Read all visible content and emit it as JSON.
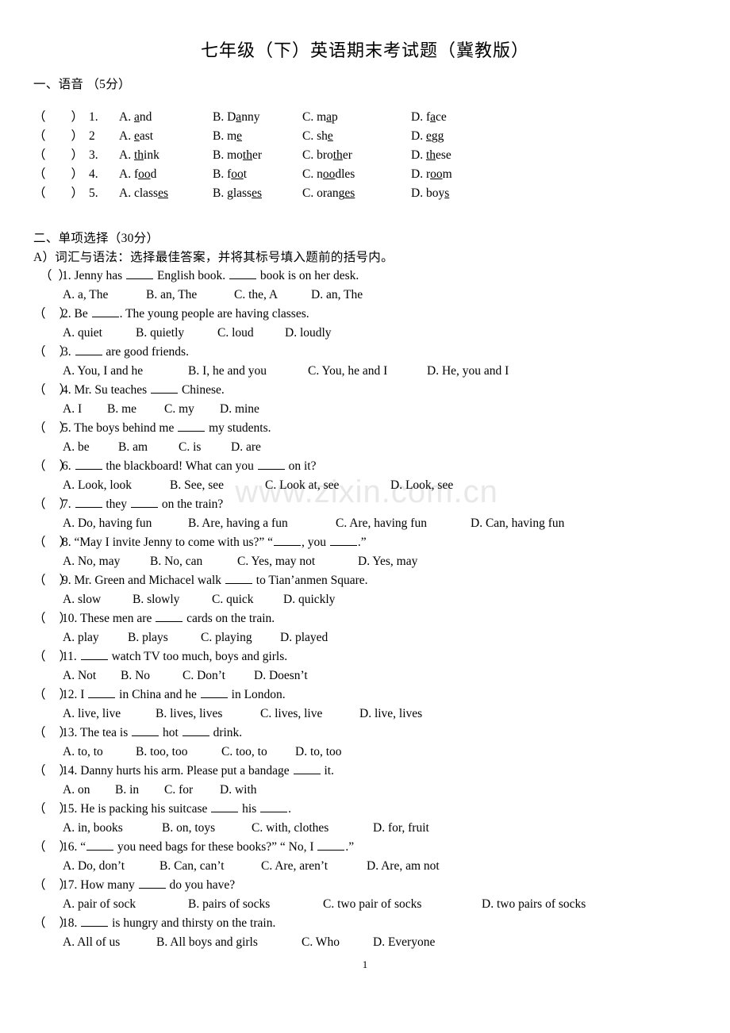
{
  "document": {
    "title": "七年级（下）英语期末考试题（冀教版）",
    "page_number": "1",
    "watermark": "www.zixin.com.cn"
  },
  "section_one": {
    "heading": "一、语音 （5分）",
    "rows": [
      {
        "number": "1.",
        "options": [
          {
            "label": "A.",
            "pre": "",
            "mark": "a",
            "post": "nd"
          },
          {
            "label": "B.",
            "pre": "D",
            "mark": "a",
            "post": "nny"
          },
          {
            "label": "C.",
            "pre": "m",
            "mark": "a",
            "post": "p"
          },
          {
            "label": "D.",
            "pre": "f",
            "mark": "a",
            "post": "ce"
          }
        ]
      },
      {
        "number": "2",
        "options": [
          {
            "label": "A.",
            "pre": "",
            "mark": "e",
            "post": "ast"
          },
          {
            "label": "B.",
            "pre": "m",
            "mark": "e",
            "post": ""
          },
          {
            "label": "C.",
            "pre": "sh",
            "mark": "e",
            "post": ""
          },
          {
            "label": "D.",
            "pre": "",
            "mark": "e",
            "post": "gg"
          }
        ]
      },
      {
        "number": "3.",
        "options": [
          {
            "label": "A.",
            "pre": "",
            "mark": "th",
            "post": "ink"
          },
          {
            "label": "B.",
            "pre": "mo",
            "mark": "th",
            "post": "er"
          },
          {
            "label": "C.",
            "pre": "bro",
            "mark": "th",
            "post": "er"
          },
          {
            "label": "D.",
            "pre": "",
            "mark": "th",
            "post": "ese"
          }
        ]
      },
      {
        "number": "4.",
        "options": [
          {
            "label": "A.",
            "pre": "f",
            "mark": "oo",
            "post": "d"
          },
          {
            "label": "B.",
            "pre": "f",
            "mark": "oo",
            "post": "t"
          },
          {
            "label": "C.",
            "pre": "n",
            "mark": "oo",
            "post": "dles"
          },
          {
            "label": "D.",
            "pre": "r",
            "mark": "oo",
            "post": "m"
          }
        ]
      },
      {
        "number": "5.",
        "options": [
          {
            "label": "A.",
            "pre": "class",
            "mark": "es",
            "post": ""
          },
          {
            "label": "B.",
            "pre": "glass",
            "mark": "es",
            "post": ""
          },
          {
            "label": "C.",
            "pre": "orang",
            "mark": "es",
            "post": ""
          },
          {
            "label": "D.",
            "pre": "boy",
            "mark": "s",
            "post": ""
          }
        ]
      }
    ]
  },
  "section_two": {
    "heading": "二、单项选择（30分）",
    "subheading": "A）词汇与语法：选择最佳答案，并将其标号填入题前的括号内。",
    "questions": [
      {
        "number": "1.",
        "indented": true,
        "stem": [
          "Jenny has ",
          " English book. ",
          " book is on her desk."
        ],
        "options": [
          "A. a, The",
          "B. an, The",
          "C. the, A",
          "D. an, The"
        ],
        "option_gaps": [
          105,
          111,
          97
        ]
      },
      {
        "number": "2.",
        "indented": false,
        "stem": [
          "Be ",
          ". The young people are having classes."
        ],
        "options": [
          "A. quiet",
          "B. quietly",
          "C. loud",
          "D. loudly"
        ],
        "option_gaps": [
          92,
          103,
          85
        ]
      },
      {
        "number": "3.",
        "indented": false,
        "stem": [
          "",
          " are good friends."
        ],
        "options": [
          "A. You, I and he",
          "B. I, he and you",
          "C. You, he and I",
          "D. He, you and I"
        ],
        "option_gaps": [
          158,
          151,
          150
        ]
      },
      {
        "number": "4.",
        "indented": false,
        "stem": [
          "Mr. Su teaches ",
          " Chinese."
        ],
        "options": [
          "A. I",
          "B. me",
          "C. my",
          "D. mine"
        ],
        "option_gaps": [
          56,
          72,
          70
        ]
      },
      {
        "number": "5.",
        "indented": false,
        "stem": [
          "The boys behind me ",
          " my students."
        ],
        "options": [
          "A. be",
          "B. am",
          "C. is",
          "D. are"
        ],
        "option_gaps": [
          70,
          76,
          66
        ]
      },
      {
        "number": "6.",
        "indented": false,
        "stem": [
          "",
          " the blackboard! What can you ",
          " on it?"
        ],
        "options": [
          "A. Look, look",
          "B. See, see",
          "C. Look at, see",
          "D. Look, see"
        ],
        "option_gaps": [
          135,
          120,
          158
        ]
      },
      {
        "number": "7.",
        "indented": false,
        "stem": [
          "",
          " they ",
          " on the train?"
        ],
        "options": [
          "A. Do, having fun",
          "B. Are, having a fun",
          "C. Are, having fun",
          "D. Can, having fun"
        ],
        "option_gaps": [
          158,
          186,
          170
        ]
      },
      {
        "number": "8.",
        "indented": false,
        "stem": [
          "“May I invite Jenny to come with us?” “",
          ", you ",
          ".”"
        ],
        "options": [
          "A. No, may",
          "B. No, can",
          "C. Yes, may not",
          "D. Yes, may"
        ],
        "option_gaps": [
          110,
          110,
          152
        ]
      },
      {
        "number": "9.",
        "indented": false,
        "stem": [
          "Mr. Green and Michacel walk ",
          " to Tian’anmen Square."
        ],
        "options": [
          "A. slow",
          "B. slowly",
          "C. quick",
          "D. quickly"
        ],
        "option_gaps": [
          88,
          100,
          90
        ]
      },
      {
        "number": "10.",
        "indented": false,
        "stem": [
          "These men are ",
          " cards on the train."
        ],
        "options": [
          "A. play",
          "B. plays",
          "C. playing",
          "D. played"
        ],
        "option_gaps": [
          82,
          92,
          100
        ]
      },
      {
        "number": "11.",
        "indented": false,
        "stem": [
          "",
          " watch TV too much, boys and girls."
        ],
        "options": [
          "A. Not",
          "B. No",
          "C. Don’t",
          "D. Doesn’t"
        ],
        "option_gaps": [
          73,
          78,
          90
        ]
      },
      {
        "number": "12.",
        "indented": false,
        "stem": [
          "I ",
          " in China and he ",
          " in London."
        ],
        "options": [
          "A. live, live",
          "B. lives, lives",
          "C. lives, live",
          "D. live, lives"
        ],
        "option_gaps": [
          117,
          132,
          125
        ]
      },
      {
        "number": "13.",
        "indented": false,
        "stem": [
          "The tea is ",
          " hot ",
          " drink."
        ],
        "options": [
          "A. to, to",
          "B. too, too",
          "C. too, to",
          "D. to, too"
        ],
        "option_gaps": [
          92,
          108,
          93
        ]
      },
      {
        "number": "14.",
        "indented": false,
        "stem": [
          "Danny hurts his arm. Please put a bandage ",
          " it."
        ],
        "options": [
          "A. on",
          "B. in",
          "C. for",
          "D. with"
        ],
        "option_gaps": [
          66,
          62,
          70
        ]
      },
      {
        "number": "15.",
        "indented": false,
        "stem": [
          "He is packing his suitcase ",
          " his ",
          "."
        ],
        "options": [
          "A. in, books",
          "B. on, toys",
          "C. with, clothes",
          "D. for, fruit"
        ],
        "option_gaps": [
          125,
          113,
          153
        ]
      },
      {
        "number": "16.",
        "indented": false,
        "stem": [
          "“",
          " you need bags for these books?” “ No, I ",
          ".”"
        ],
        "options": [
          "A. Do, don’t",
          "B. Can, can’t",
          "C. Are, aren’t",
          "D. Are, am not"
        ],
        "option_gaps": [
          122,
          128,
          133
        ]
      },
      {
        "number": "17.",
        "indented": false,
        "stem": [
          "How many ",
          " do you have?"
        ],
        "options": [
          "A. pair of sock",
          "B. pairs of socks",
          "C. two pair of socks",
          "D. two pairs of socks"
        ],
        "option_gaps": [
          158,
          170,
          200
        ]
      },
      {
        "number": "18.",
        "indented": false,
        "stem": [
          "",
          " is hungry and thirsty on the train."
        ],
        "options": [
          "A. All of us",
          "B. All boys and girls",
          "C. Who",
          "D. Everyone"
        ],
        "option_gaps": [
          118,
          183,
          90
        ]
      }
    ]
  }
}
